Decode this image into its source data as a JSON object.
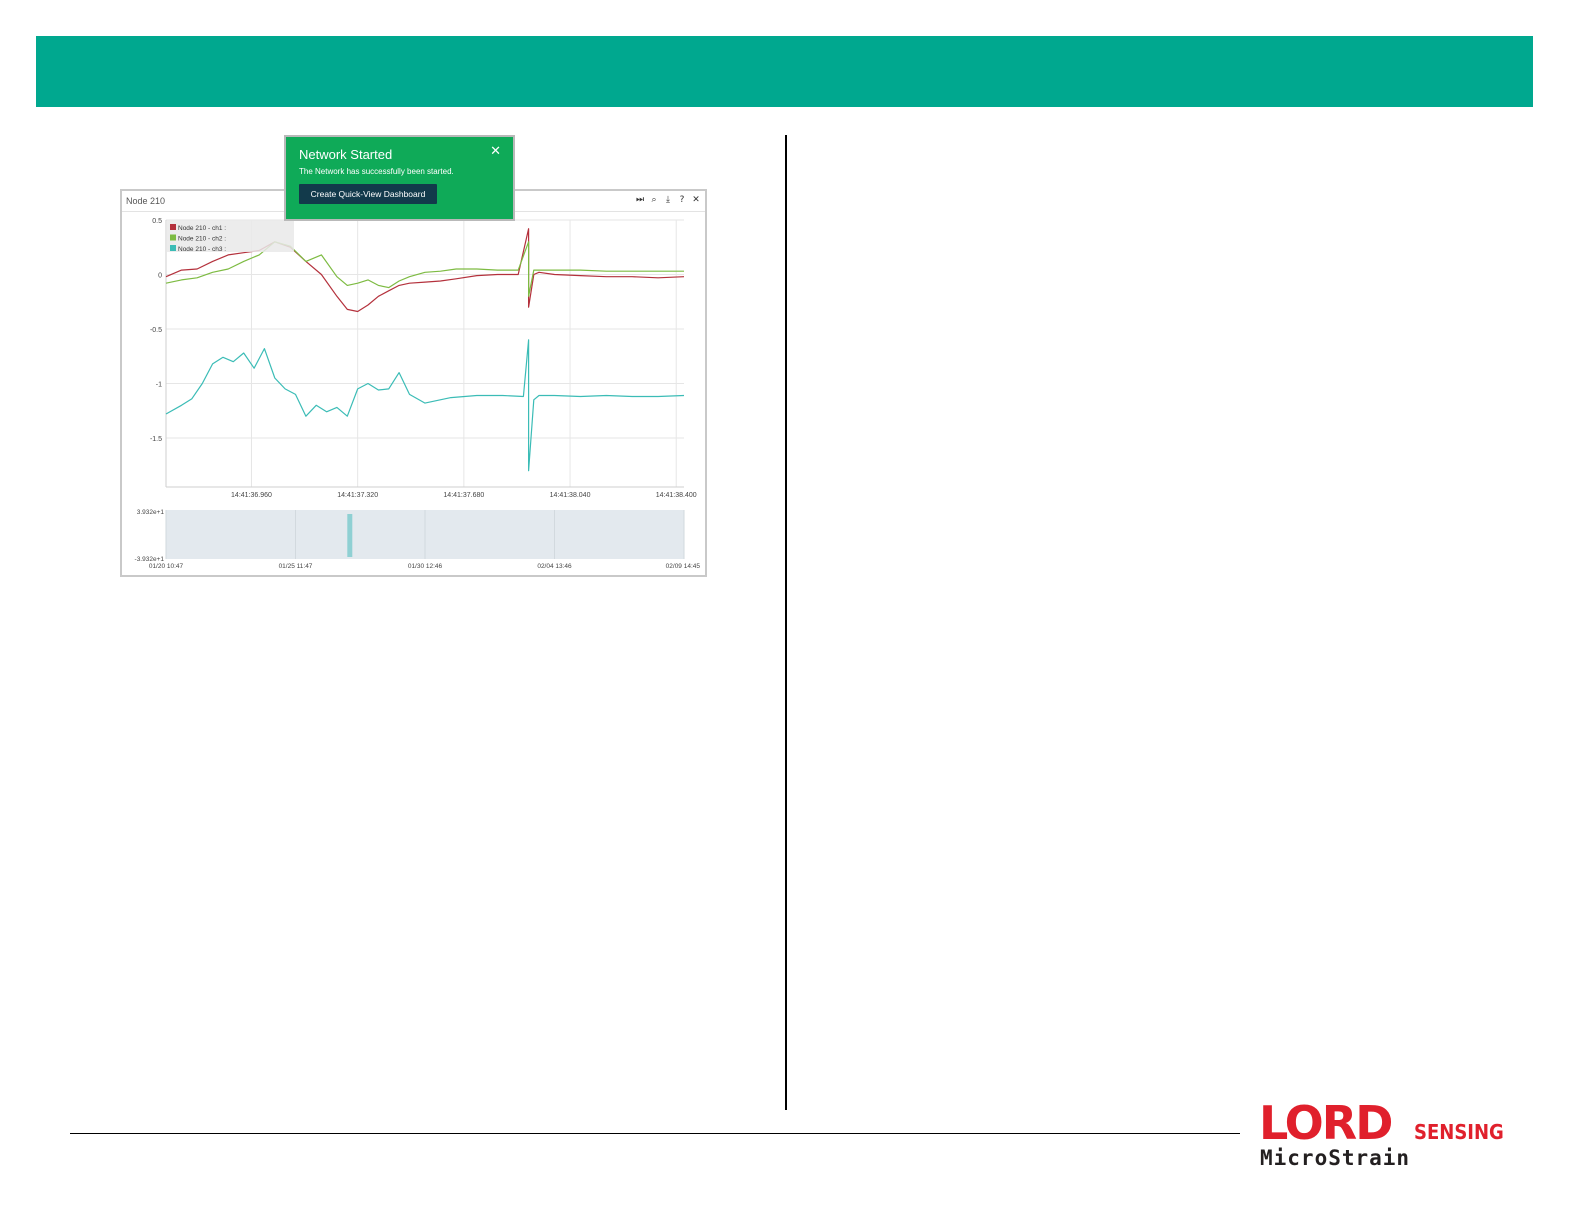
{
  "colors": {
    "header_bar": "#00a88f",
    "toast_bg": "#0faa58",
    "toast_button_bg": "#123a4b",
    "ch1": "#b4313c",
    "ch2": "#7dbb42",
    "ch3": "#3bbcb6",
    "brand_red": "#e0202c"
  },
  "brand": {
    "lord": "LORD",
    "sensing": "SENSING",
    "microstrain": "MicroStrain"
  },
  "panel": {
    "title": "Node 210",
    "tools": [
      "skip-end-icon",
      "zoom-icon",
      "download-icon",
      "help-icon",
      "close-icon"
    ]
  },
  "toast": {
    "title": "Network Started",
    "message": "The Network has successfully been started.",
    "button_label": "Create Quick-View Dashboard",
    "close_glyph": "✕"
  },
  "chart_data": [
    {
      "type": "line",
      "legend": [
        "Node 210 - ch1 :",
        "Node 210 - ch2 :",
        "Node 210 - ch3 :"
      ],
      "legend_placement": "top-left",
      "grid": true,
      "yticks": [
        "0.5",
        "0",
        "-0.5",
        "-1",
        "-1.5"
      ],
      "xticks": [
        "14:41:36.960",
        "14:41:37.320",
        "14:41:37.680",
        "14:41:38.040",
        "14:41:38.400"
      ],
      "ylim": [
        -1.95,
        0.5
      ],
      "series": [
        {
          "name": "Node 210 - ch1 :",
          "x": [
            0,
            0.03,
            0.06,
            0.09,
            0.12,
            0.15,
            0.18,
            0.21,
            0.24,
            0.27,
            0.3,
            0.33,
            0.35,
            0.37,
            0.39,
            0.41,
            0.43,
            0.45,
            0.47,
            0.5,
            0.53,
            0.56,
            0.6,
            0.64,
            0.68,
            0.7,
            0.7,
            0.71,
            0.72,
            0.75,
            0.8,
            0.85,
            0.9,
            0.95,
            1.0
          ],
          "values": [
            -0.02,
            0.04,
            0.05,
            0.12,
            0.18,
            0.2,
            0.22,
            0.3,
            0.25,
            0.12,
            0.0,
            -0.2,
            -0.32,
            -0.34,
            -0.28,
            -0.2,
            -0.15,
            -0.1,
            -0.08,
            -0.07,
            -0.06,
            -0.04,
            -0.01,
            0.0,
            0.0,
            0.42,
            -0.3,
            0.0,
            0.02,
            0.0,
            -0.01,
            -0.02,
            -0.02,
            -0.03,
            -0.02
          ]
        },
        {
          "name": "Node 210 - ch2 :",
          "x": [
            0,
            0.03,
            0.06,
            0.09,
            0.12,
            0.15,
            0.18,
            0.21,
            0.24,
            0.27,
            0.3,
            0.33,
            0.35,
            0.37,
            0.39,
            0.41,
            0.43,
            0.45,
            0.47,
            0.5,
            0.53,
            0.56,
            0.6,
            0.64,
            0.68,
            0.7,
            0.7,
            0.71,
            0.72,
            0.75,
            0.8,
            0.85,
            0.9,
            0.95,
            1.0
          ],
          "values": [
            -0.08,
            -0.05,
            -0.03,
            0.02,
            0.05,
            0.12,
            0.18,
            0.3,
            0.26,
            0.12,
            0.18,
            -0.02,
            -0.1,
            -0.08,
            -0.05,
            -0.1,
            -0.12,
            -0.06,
            -0.02,
            0.02,
            0.03,
            0.05,
            0.05,
            0.04,
            0.04,
            0.3,
            -0.2,
            0.04,
            0.04,
            0.04,
            0.04,
            0.03,
            0.03,
            0.03,
            0.03
          ]
        },
        {
          "name": "Node 210 - ch3 :",
          "x": [
            0,
            0.03,
            0.05,
            0.07,
            0.09,
            0.11,
            0.13,
            0.15,
            0.17,
            0.19,
            0.21,
            0.23,
            0.25,
            0.27,
            0.29,
            0.31,
            0.33,
            0.35,
            0.37,
            0.39,
            0.41,
            0.43,
            0.45,
            0.47,
            0.5,
            0.55,
            0.6,
            0.65,
            0.69,
            0.7,
            0.7,
            0.71,
            0.72,
            0.75,
            0.8,
            0.85,
            0.9,
            0.95,
            1.0
          ],
          "values": [
            -1.28,
            -1.2,
            -1.14,
            -1.0,
            -0.82,
            -0.76,
            -0.8,
            -0.72,
            -0.86,
            -0.68,
            -0.95,
            -1.05,
            -1.1,
            -1.3,
            -1.2,
            -1.26,
            -1.22,
            -1.3,
            -1.05,
            -1.0,
            -1.06,
            -1.05,
            -0.9,
            -1.1,
            -1.18,
            -1.13,
            -1.11,
            -1.11,
            -1.12,
            -0.6,
            -1.8,
            -1.15,
            -1.11,
            -1.11,
            -1.12,
            -1.11,
            -1.12,
            -1.12,
            -1.11
          ]
        }
      ]
    },
    {
      "type": "area",
      "yticks": [
        "3.932e+1",
        "-3.932e+1"
      ],
      "xticks": [
        "01/20 10:47",
        "01/25 11:47",
        "01/30 12:46",
        "02/04 13:46",
        "02/09 14:45"
      ],
      "ylim": [
        -39.32,
        39.32
      ],
      "grid": true,
      "highlight_x_fraction": 0.35
    }
  ]
}
